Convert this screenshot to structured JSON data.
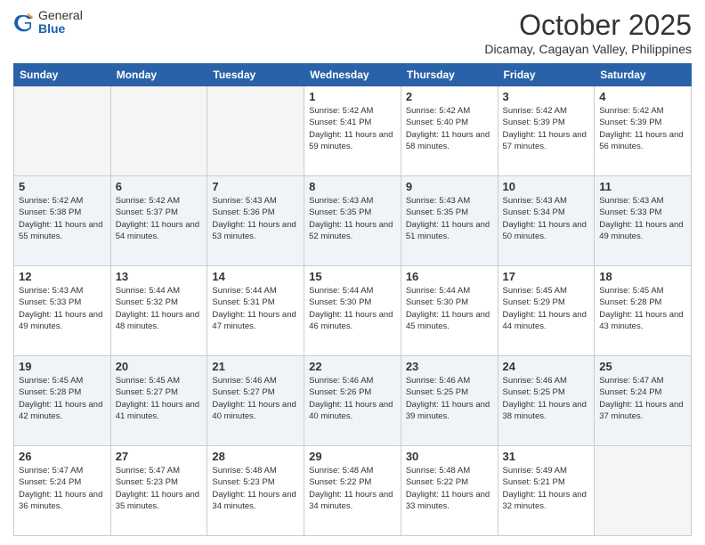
{
  "header": {
    "logo": {
      "general": "General",
      "blue": "Blue"
    },
    "title": "October 2025",
    "location": "Dicamay, Cagayan Valley, Philippines"
  },
  "days_of_week": [
    "Sunday",
    "Monday",
    "Tuesday",
    "Wednesday",
    "Thursday",
    "Friday",
    "Saturday"
  ],
  "weeks": [
    [
      {
        "day": "",
        "sunrise": "",
        "sunset": "",
        "daylight": "",
        "empty": true
      },
      {
        "day": "",
        "sunrise": "",
        "sunset": "",
        "daylight": "",
        "empty": true
      },
      {
        "day": "",
        "sunrise": "",
        "sunset": "",
        "daylight": "",
        "empty": true
      },
      {
        "day": "1",
        "sunrise": "Sunrise: 5:42 AM",
        "sunset": "Sunset: 5:41 PM",
        "daylight": "Daylight: 11 hours and 59 minutes.",
        "empty": false
      },
      {
        "day": "2",
        "sunrise": "Sunrise: 5:42 AM",
        "sunset": "Sunset: 5:40 PM",
        "daylight": "Daylight: 11 hours and 58 minutes.",
        "empty": false
      },
      {
        "day": "3",
        "sunrise": "Sunrise: 5:42 AM",
        "sunset": "Sunset: 5:39 PM",
        "daylight": "Daylight: 11 hours and 57 minutes.",
        "empty": false
      },
      {
        "day": "4",
        "sunrise": "Sunrise: 5:42 AM",
        "sunset": "Sunset: 5:39 PM",
        "daylight": "Daylight: 11 hours and 56 minutes.",
        "empty": false
      }
    ],
    [
      {
        "day": "5",
        "sunrise": "Sunrise: 5:42 AM",
        "sunset": "Sunset: 5:38 PM",
        "daylight": "Daylight: 11 hours and 55 minutes.",
        "empty": false
      },
      {
        "day": "6",
        "sunrise": "Sunrise: 5:42 AM",
        "sunset": "Sunset: 5:37 PM",
        "daylight": "Daylight: 11 hours and 54 minutes.",
        "empty": false
      },
      {
        "day": "7",
        "sunrise": "Sunrise: 5:43 AM",
        "sunset": "Sunset: 5:36 PM",
        "daylight": "Daylight: 11 hours and 53 minutes.",
        "empty": false
      },
      {
        "day": "8",
        "sunrise": "Sunrise: 5:43 AM",
        "sunset": "Sunset: 5:35 PM",
        "daylight": "Daylight: 11 hours and 52 minutes.",
        "empty": false
      },
      {
        "day": "9",
        "sunrise": "Sunrise: 5:43 AM",
        "sunset": "Sunset: 5:35 PM",
        "daylight": "Daylight: 11 hours and 51 minutes.",
        "empty": false
      },
      {
        "day": "10",
        "sunrise": "Sunrise: 5:43 AM",
        "sunset": "Sunset: 5:34 PM",
        "daylight": "Daylight: 11 hours and 50 minutes.",
        "empty": false
      },
      {
        "day": "11",
        "sunrise": "Sunrise: 5:43 AM",
        "sunset": "Sunset: 5:33 PM",
        "daylight": "Daylight: 11 hours and 49 minutes.",
        "empty": false
      }
    ],
    [
      {
        "day": "12",
        "sunrise": "Sunrise: 5:43 AM",
        "sunset": "Sunset: 5:33 PM",
        "daylight": "Daylight: 11 hours and 49 minutes.",
        "empty": false
      },
      {
        "day": "13",
        "sunrise": "Sunrise: 5:44 AM",
        "sunset": "Sunset: 5:32 PM",
        "daylight": "Daylight: 11 hours and 48 minutes.",
        "empty": false
      },
      {
        "day": "14",
        "sunrise": "Sunrise: 5:44 AM",
        "sunset": "Sunset: 5:31 PM",
        "daylight": "Daylight: 11 hours and 47 minutes.",
        "empty": false
      },
      {
        "day": "15",
        "sunrise": "Sunrise: 5:44 AM",
        "sunset": "Sunset: 5:30 PM",
        "daylight": "Daylight: 11 hours and 46 minutes.",
        "empty": false
      },
      {
        "day": "16",
        "sunrise": "Sunrise: 5:44 AM",
        "sunset": "Sunset: 5:30 PM",
        "daylight": "Daylight: 11 hours and 45 minutes.",
        "empty": false
      },
      {
        "day": "17",
        "sunrise": "Sunrise: 5:45 AM",
        "sunset": "Sunset: 5:29 PM",
        "daylight": "Daylight: 11 hours and 44 minutes.",
        "empty": false
      },
      {
        "day": "18",
        "sunrise": "Sunrise: 5:45 AM",
        "sunset": "Sunset: 5:28 PM",
        "daylight": "Daylight: 11 hours and 43 minutes.",
        "empty": false
      }
    ],
    [
      {
        "day": "19",
        "sunrise": "Sunrise: 5:45 AM",
        "sunset": "Sunset: 5:28 PM",
        "daylight": "Daylight: 11 hours and 42 minutes.",
        "empty": false
      },
      {
        "day": "20",
        "sunrise": "Sunrise: 5:45 AM",
        "sunset": "Sunset: 5:27 PM",
        "daylight": "Daylight: 11 hours and 41 minutes.",
        "empty": false
      },
      {
        "day": "21",
        "sunrise": "Sunrise: 5:46 AM",
        "sunset": "Sunset: 5:27 PM",
        "daylight": "Daylight: 11 hours and 40 minutes.",
        "empty": false
      },
      {
        "day": "22",
        "sunrise": "Sunrise: 5:46 AM",
        "sunset": "Sunset: 5:26 PM",
        "daylight": "Daylight: 11 hours and 40 minutes.",
        "empty": false
      },
      {
        "day": "23",
        "sunrise": "Sunrise: 5:46 AM",
        "sunset": "Sunset: 5:25 PM",
        "daylight": "Daylight: 11 hours and 39 minutes.",
        "empty": false
      },
      {
        "day": "24",
        "sunrise": "Sunrise: 5:46 AM",
        "sunset": "Sunset: 5:25 PM",
        "daylight": "Daylight: 11 hours and 38 minutes.",
        "empty": false
      },
      {
        "day": "25",
        "sunrise": "Sunrise: 5:47 AM",
        "sunset": "Sunset: 5:24 PM",
        "daylight": "Daylight: 11 hours and 37 minutes.",
        "empty": false
      }
    ],
    [
      {
        "day": "26",
        "sunrise": "Sunrise: 5:47 AM",
        "sunset": "Sunset: 5:24 PM",
        "daylight": "Daylight: 11 hours and 36 minutes.",
        "empty": false
      },
      {
        "day": "27",
        "sunrise": "Sunrise: 5:47 AM",
        "sunset": "Sunset: 5:23 PM",
        "daylight": "Daylight: 11 hours and 35 minutes.",
        "empty": false
      },
      {
        "day": "28",
        "sunrise": "Sunrise: 5:48 AM",
        "sunset": "Sunset: 5:23 PM",
        "daylight": "Daylight: 11 hours and 34 minutes.",
        "empty": false
      },
      {
        "day": "29",
        "sunrise": "Sunrise: 5:48 AM",
        "sunset": "Sunset: 5:22 PM",
        "daylight": "Daylight: 11 hours and 34 minutes.",
        "empty": false
      },
      {
        "day": "30",
        "sunrise": "Sunrise: 5:48 AM",
        "sunset": "Sunset: 5:22 PM",
        "daylight": "Daylight: 11 hours and 33 minutes.",
        "empty": false
      },
      {
        "day": "31",
        "sunrise": "Sunrise: 5:49 AM",
        "sunset": "Sunset: 5:21 PM",
        "daylight": "Daylight: 11 hours and 32 minutes.",
        "empty": false
      },
      {
        "day": "",
        "sunrise": "",
        "sunset": "",
        "daylight": "",
        "empty": true
      }
    ]
  ]
}
